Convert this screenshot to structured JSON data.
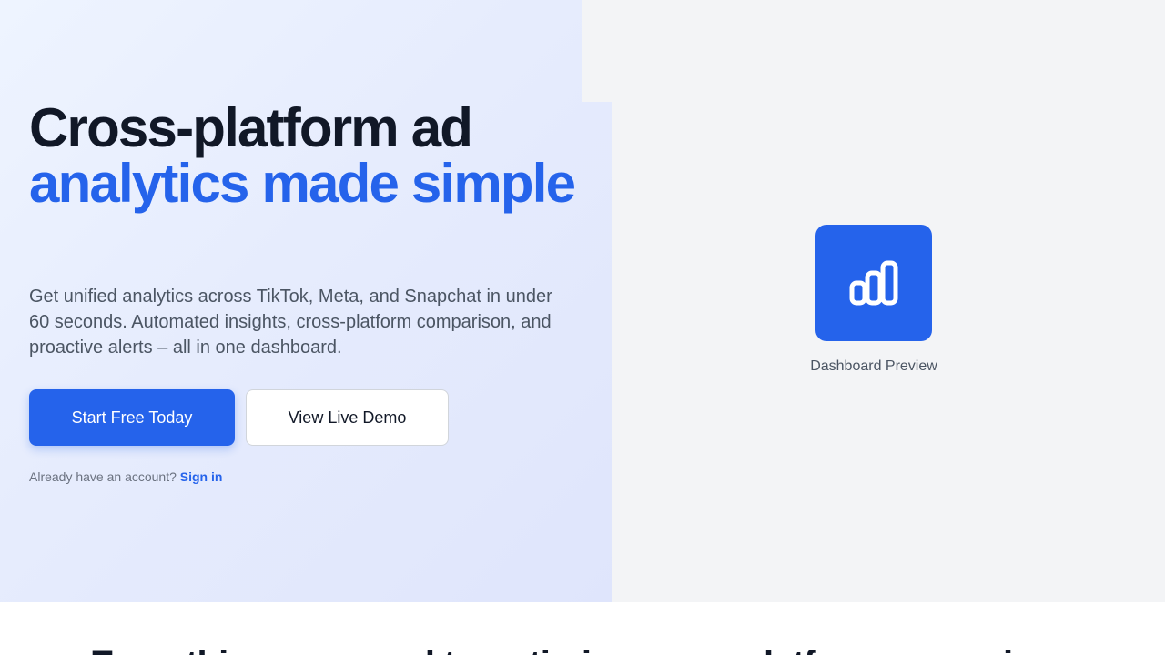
{
  "hero": {
    "headline_line1": "Cross-platform ad",
    "headline_accent": "analytics made simple",
    "subtext": "Get unified analytics across TikTok, Meta, and Snapchat in under 60 seconds. Automated insights, cross-platform comparison, and proactive alerts – all in one dashboard.",
    "primary_cta": "Start Free Today",
    "secondary_cta": "View Live Demo",
    "account_prompt": "Already have an account?",
    "signin_link": "Sign in"
  },
  "preview": {
    "icon": "bar-chart-icon",
    "label": "Dashboard Preview"
  },
  "features": {
    "heading": "Everything you need to optimize cross-platform campaigns"
  },
  "colors": {
    "accent": "#2563eb",
    "heading": "#111827",
    "body_text": "#4b5563",
    "muted_text": "#6b7280",
    "preview_bg": "#f3f4f6"
  }
}
